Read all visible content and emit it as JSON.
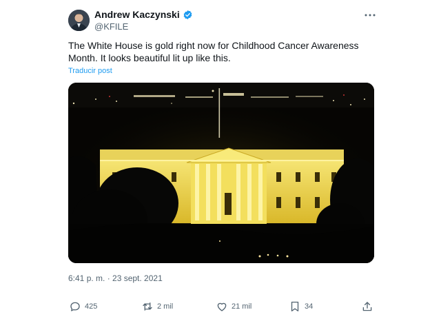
{
  "author": {
    "display_name": "Andrew Kaczynski",
    "handle": "@KFILE",
    "verified": true
  },
  "tweet": {
    "text": "The White House is gold right now for Childhood Cancer Awareness Month. It looks beautiful lit up like this.",
    "translate_label": "Traducir post",
    "timestamp": "6:41 p. m. · 23 sept. 2021"
  },
  "media": {
    "subject": "White House lit up gold at night"
  },
  "actions": {
    "replies": "425",
    "reposts": "2 mil",
    "likes": "21 mil",
    "bookmarks": "34"
  },
  "colors": {
    "accent": "#1d9bf0",
    "secondary_text": "#536471",
    "gold_light": "#f1d441"
  },
  "icons": [
    "verified-badge-icon",
    "more-icon",
    "reply-icon",
    "repost-icon",
    "like-icon",
    "bookmark-icon",
    "share-icon"
  ]
}
